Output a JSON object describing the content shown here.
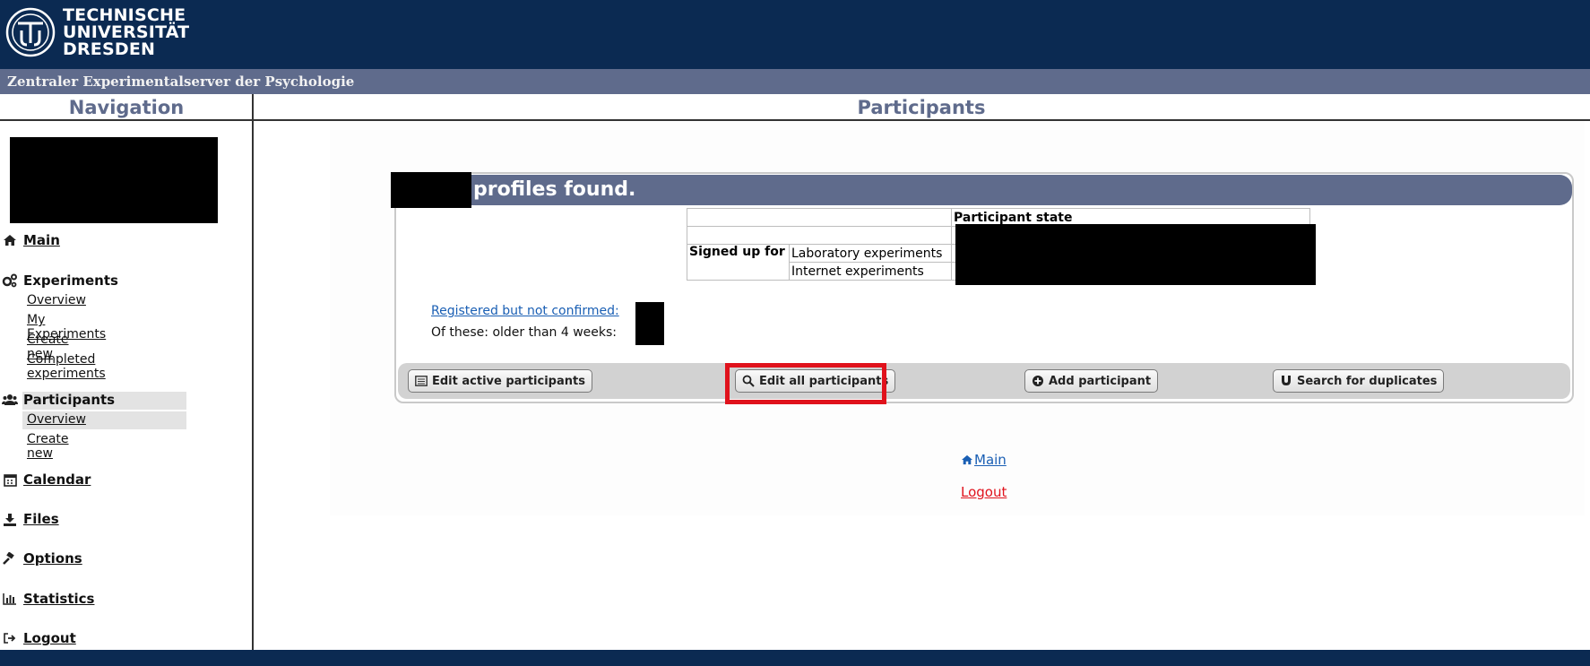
{
  "header": {
    "logo_line1": "TECHNISCHE",
    "logo_line2": "UNIVERSITÄT",
    "logo_line3": "DRESDEN",
    "subtitle": "Zentraler Experimentalserver der Psychologie"
  },
  "nav": {
    "heading": "Navigation",
    "main": "Main",
    "experiments": "Experiments",
    "experiments_items": [
      "Overview",
      "My Experiments",
      "Create new",
      "Completed experiments"
    ],
    "participants": "Participants",
    "participants_items": [
      "Overview",
      "Create new"
    ],
    "calendar": "Calendar",
    "files": "Files",
    "options": "Options",
    "statistics": "Statistics",
    "logout": "Logout"
  },
  "main": {
    "heading": "Participants",
    "profiles_found": "profiles found.",
    "stats_header": "Participant state",
    "signed_up_for": "Signed up for",
    "lab_experiments": "Laboratory experiments",
    "internet_experiments": "Internet experiments",
    "registered_not_confirmed": "Registered but not confirmed:",
    "older_than": "Of these: older than 4 weeks:",
    "buttons": {
      "edit_active": "Edit active participants",
      "edit_all": "Edit all participants",
      "add": "Add participant",
      "duplicates": "Search for duplicates"
    },
    "link_main": "Main",
    "link_logout": "Logout"
  },
  "colors": {
    "header_bg": "#0b2a52",
    "accent": "#5f6b8c",
    "highlight": "#e0121c",
    "link": "#1a5fb4"
  }
}
